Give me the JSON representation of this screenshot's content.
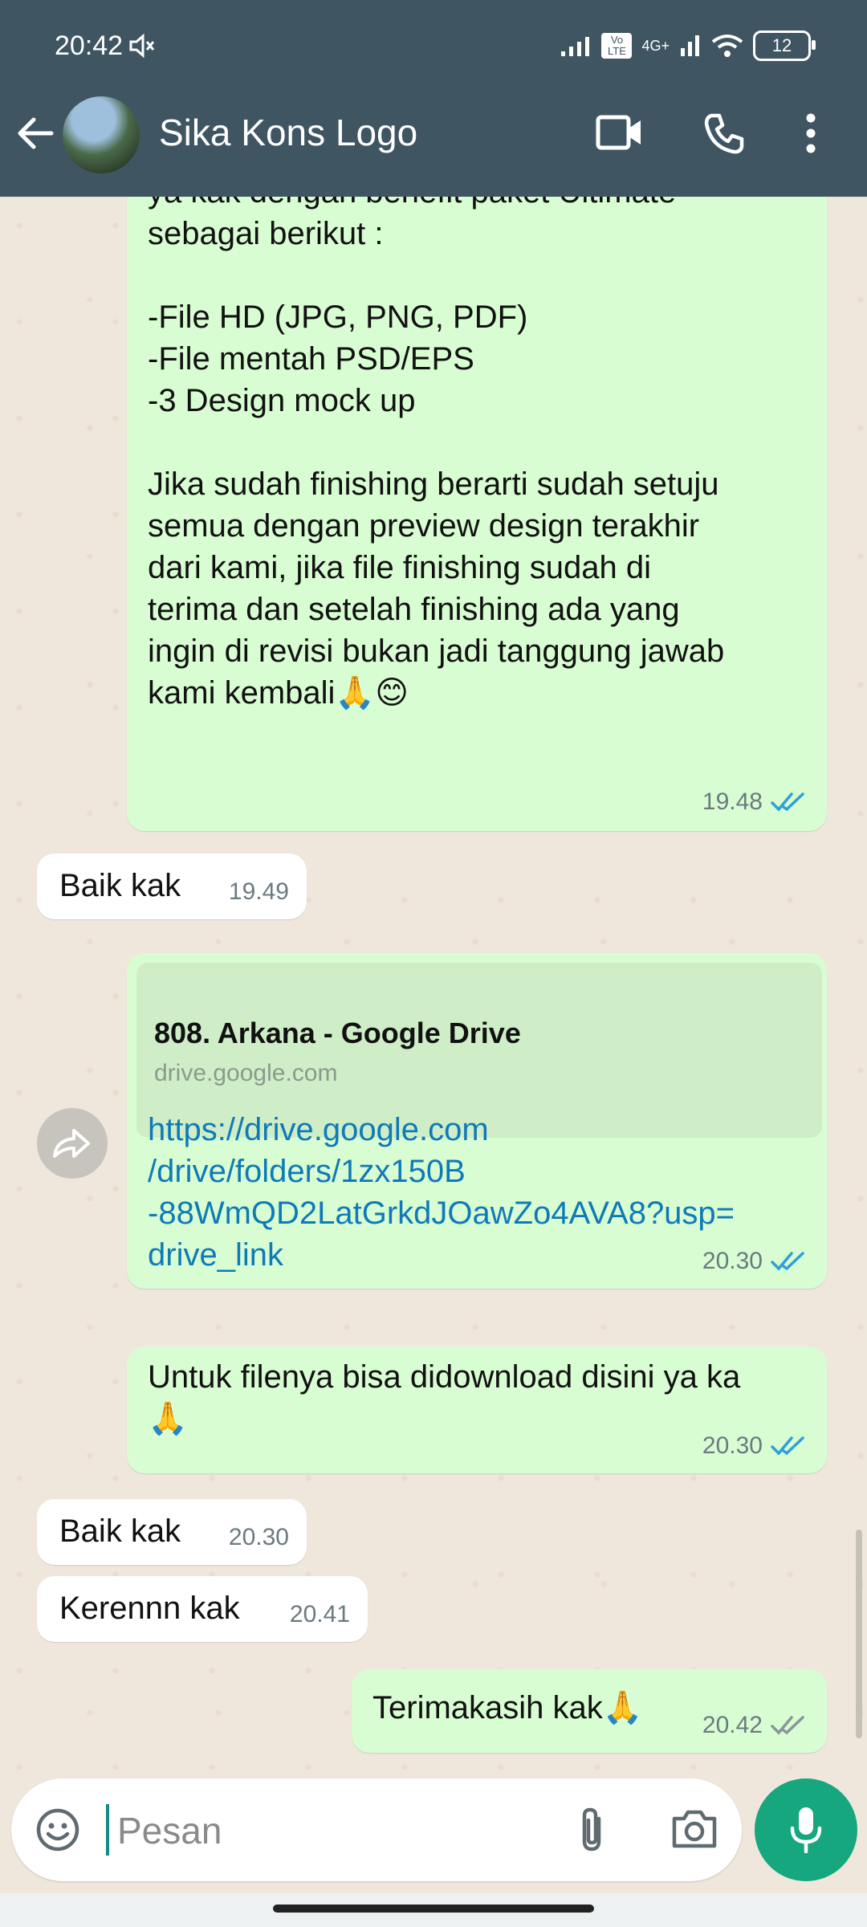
{
  "status_bar": {
    "time": "20:42",
    "network": "4G+",
    "volte": "Vo LTE",
    "battery": "12"
  },
  "header": {
    "title": "Sika Kons Logo"
  },
  "messages": [
    {
      "id": "m1",
      "direction": "outgoing",
      "text_top": "ya kak dengan benefit paket Ultimate\nsebagai berikut :",
      "text_list": "-File HD (JPG, PNG, PDF)\n-File mentah PSD/EPS\n-3 Design mock up",
      "text_body": "Jika sudah finishing berarti sudah setuju\nsemua dengan preview design terakhir\ndari kami, jika file finishing sudah di\nterima dan setelah finishing ada yang\ningin di revisi bukan jadi tanggung jawab\nkami kembali🙏😊",
      "time": "19.48",
      "status": "read"
    },
    {
      "id": "m2",
      "direction": "incoming",
      "text": "Baik kak",
      "time": "19.49"
    },
    {
      "id": "m3",
      "direction": "outgoing",
      "link_title": "808. Arkana - Google Drive",
      "link_domain": "drive.google.com",
      "link_url": "https://drive.google.com\n/drive/folders/1zx150B\n-88WmQD2LatGrkdJOawZo4AVA8?usp=\ndrive_link",
      "time": "20.30",
      "status": "read"
    },
    {
      "id": "m4",
      "direction": "outgoing",
      "text": "Untuk filenya bisa didownload disini ya ka\n🙏",
      "time": "20.30",
      "status": "read"
    },
    {
      "id": "m5",
      "direction": "incoming",
      "text": "Baik kak",
      "time": "20.30"
    },
    {
      "id": "m6",
      "direction": "incoming",
      "text": "Kerennn kak",
      "time": "20.41"
    },
    {
      "id": "m7",
      "direction": "outgoing",
      "text": "Terimakasih kak🙏",
      "time": "20.42",
      "status": "delivered"
    }
  ],
  "composer": {
    "placeholder": "Pesan"
  },
  "colors": {
    "header_bg": "#3f5562",
    "outgoing_bubble": "#d9fdd3",
    "incoming_bubble": "#ffffff",
    "read_tick": "#2e9fd8",
    "delivered_tick": "#8a9599",
    "mic_button": "#16a77e",
    "link_text": "#0f7ab8"
  },
  "icons": {
    "back": "arrow-left-icon",
    "video": "video-camera-icon",
    "call": "phone-icon",
    "menu": "more-vertical-icon",
    "forward": "forward-icon",
    "emoji": "smiley-icon",
    "attach": "paperclip-icon",
    "camera": "camera-icon",
    "mic": "microphone-icon"
  }
}
